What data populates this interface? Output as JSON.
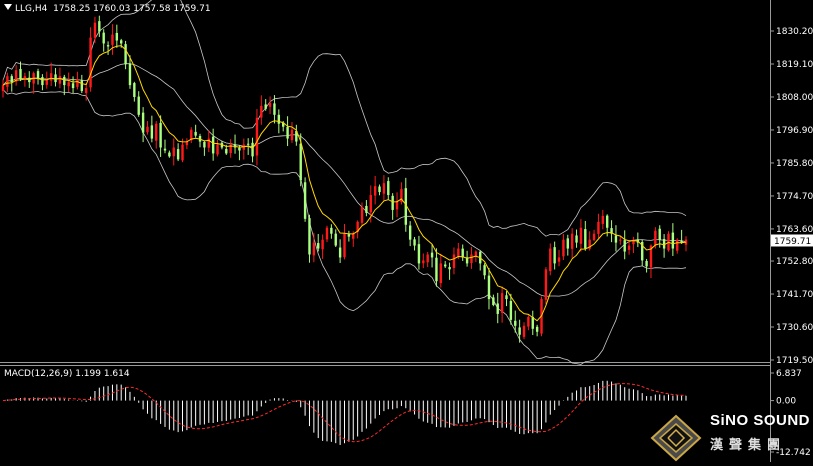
{
  "header": {
    "symbol_tf": "LLG,H4",
    "ohlc": "1758.25 1760.03 1757.58 1759.71"
  },
  "macd": {
    "label": "MACD(12,26,9) 1.199 1.614",
    "axis_ticks": [
      "6.837",
      "0.00",
      "-12.742"
    ],
    "ylim": [
      -12.742,
      6.837
    ]
  },
  "price_axis": {
    "ticks": [
      "1830.20",
      "1819.10",
      "1808.00",
      "1796.90",
      "1785.80",
      "1774.70",
      "1763.60",
      "1752.80",
      "1741.70",
      "1730.60",
      "1719.50"
    ],
    "tick_values": [
      1830.2,
      1819.1,
      1808.0,
      1796.9,
      1785.8,
      1774.7,
      1763.6,
      1752.8,
      1741.7,
      1730.6,
      1719.5
    ],
    "current_price": "1759.71"
  },
  "colors": {
    "bull": "#ff1a1a",
    "bear": "#aaff80",
    "ma": "#ffd700",
    "bands": "#c8c8c8",
    "signal": "#ff2a2a",
    "hist": "#ffffff",
    "grid": "#9a9a9a"
  },
  "chart_data": {
    "type": "candlestick",
    "ylim": [
      1717.0,
      1838.0
    ],
    "closes": [
      1812,
      1815,
      1813,
      1817,
      1814,
      1815,
      1813,
      1816,
      1814,
      1812,
      1814,
      1816,
      1813,
      1815,
      1812,
      1813,
      1811,
      1814,
      1810,
      1811,
      1828,
      1833,
      1830,
      1826,
      1825,
      1829,
      1827,
      1826,
      1819,
      1812,
      1808,
      1802,
      1796,
      1798,
      1794,
      1799,
      1791,
      1790,
      1788,
      1791,
      1787,
      1792,
      1793,
      1797,
      1795,
      1793,
      1791,
      1794,
      1789,
      1792,
      1791,
      1789,
      1792,
      1791,
      1790,
      1792,
      1792,
      1788,
      1801,
      1805,
      1804,
      1806,
      1802,
      1799,
      1798,
      1794,
      1797,
      1793,
      1780,
      1767,
      1755,
      1759,
      1757,
      1760,
      1764,
      1762,
      1758,
      1754,
      1762,
      1761,
      1762,
      1766,
      1771,
      1769,
      1775,
      1778,
      1776,
      1779,
      1775,
      1770,
      1773,
      1777,
      1765,
      1760,
      1758,
      1752,
      1753,
      1755,
      1754,
      1746,
      1752,
      1751,
      1750,
      1755,
      1757,
      1754,
      1752,
      1755,
      1756,
      1752,
      1748,
      1740,
      1738,
      1735,
      1742,
      1740,
      1733,
      1731,
      1728,
      1731,
      1734,
      1730,
      1729,
      1740,
      1750,
      1757,
      1752,
      1754,
      1760,
      1757,
      1762,
      1759,
      1764,
      1757,
      1760,
      1762,
      1766,
      1768,
      1764,
      1762,
      1759,
      1760,
      1756,
      1758,
      1760,
      1759,
      1753,
      1751,
      1758,
      1763,
      1760,
      1757,
      1762,
      1757,
      1760,
      1759,
      1760
    ]
  }
}
